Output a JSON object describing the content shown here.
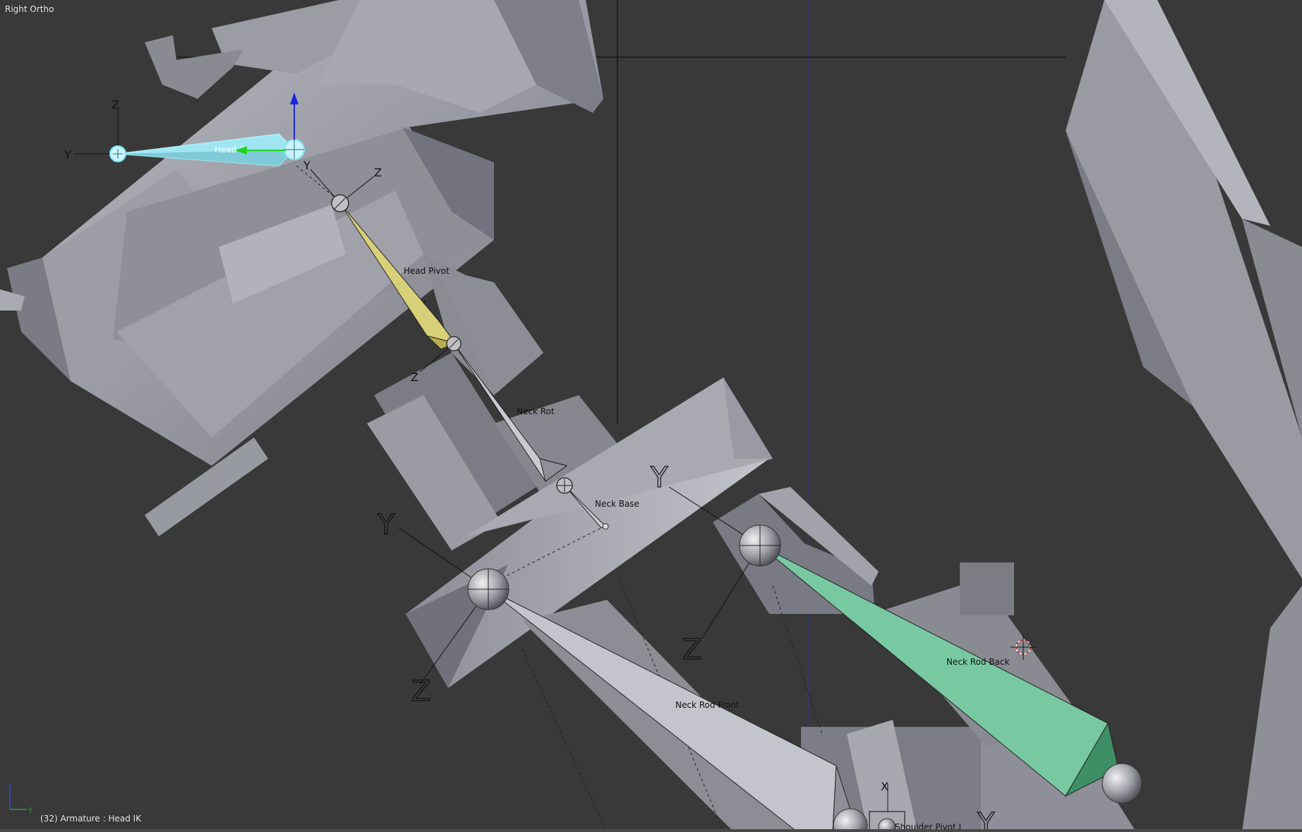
{
  "viewport": {
    "view_label": "Right Ortho",
    "status_text": "(32) Armature : Head IK",
    "axis_labels": {
      "y": "y",
      "z": "z"
    }
  },
  "bones": [
    {
      "id": "head-ik",
      "label": "Head IK",
      "color": "#9fe6f2",
      "selected": true
    },
    {
      "id": "head-pivot",
      "label": "Head Pivot",
      "color": "#d3cc70",
      "selected": false
    },
    {
      "id": "neck-rot",
      "label": "Neck  Rot",
      "color": "#c7c7cf",
      "selected": false
    },
    {
      "id": "neck-base",
      "label": "Neck Base",
      "color": "#c7c7cf",
      "selected": false
    },
    {
      "id": "neck-rod-front",
      "label": "Neck Rod Front",
      "color": "#c4c4cc",
      "selected": false
    },
    {
      "id": "neck-rod-back",
      "label": "Neck Rod Back",
      "color": "#72c7a0",
      "selected": false
    },
    {
      "id": "shoulder-pivot-l",
      "label": "Shoulder Pivot.L",
      "color": "#c7c7cf",
      "selected": false
    }
  ],
  "bone_axes": {
    "x": "X",
    "y": "Y",
    "z": "Z"
  },
  "colors": {
    "background": "#393939",
    "mesh_light": "#a9a9b2",
    "mesh_dark": "#6f6f78",
    "axis_x": "#c8322f",
    "axis_y": "#2f9a2f",
    "axis_z": "#2f52d6",
    "selected_bone": "#9fe6f2",
    "manipulator_y": "#1fd31f",
    "manipulator_z": "#1b26e6"
  },
  "icons": [
    "orientation-axes-icon",
    "3d-cursor-icon",
    "transform-manipulator-icon"
  ]
}
